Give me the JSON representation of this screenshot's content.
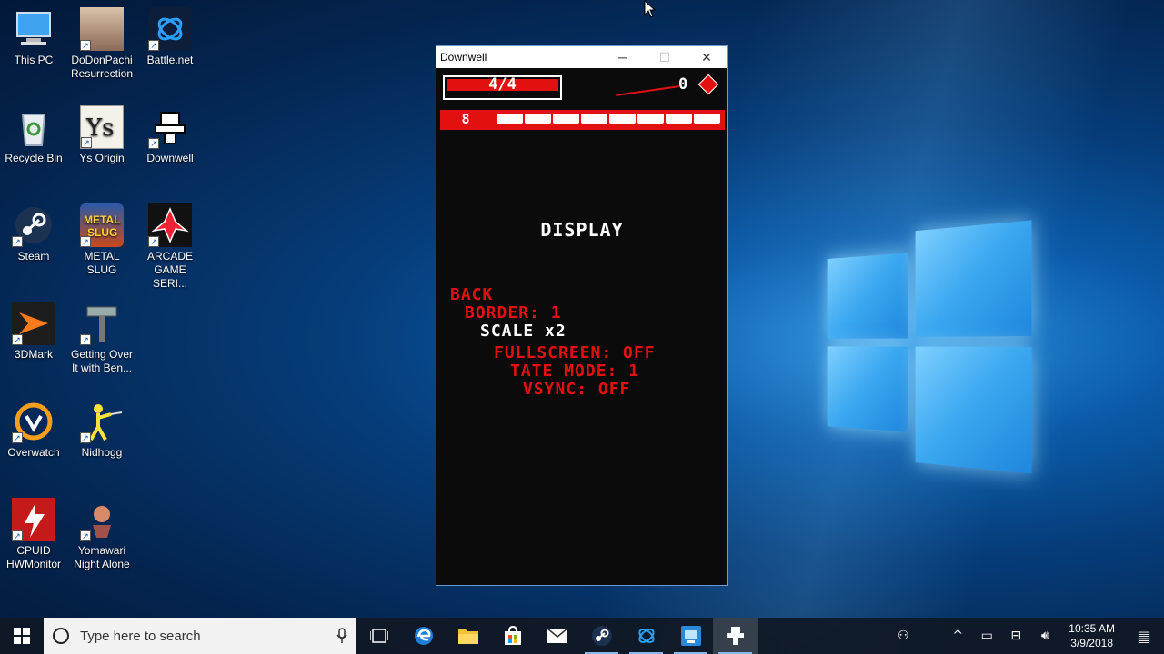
{
  "desktop": {
    "icons": [
      {
        "label": "This PC",
        "icon": "computer-icon"
      },
      {
        "label": "DoDonPachi Resurrection",
        "icon": "game-art-icon"
      },
      {
        "label": "Battle.net",
        "icon": "battlenet-icon"
      },
      {
        "label": "Recycle Bin",
        "icon": "recycle-bin-icon"
      },
      {
        "label": "Ys Origin",
        "icon": "ys-origin-icon"
      },
      {
        "label": "Downwell",
        "icon": "downwell-icon"
      },
      {
        "label": "Steam",
        "icon": "steam-icon"
      },
      {
        "label": "METAL SLUG",
        "icon": "metal-slug-icon"
      },
      {
        "label": "ARCADE GAME SERI...",
        "icon": "galaga-icon"
      },
      {
        "label": "3DMark",
        "icon": "3dmark-icon"
      },
      {
        "label": "Getting Over It with Ben...",
        "icon": "hammer-icon"
      },
      {
        "label": "Overwatch",
        "icon": "overwatch-icon"
      },
      {
        "label": "Nidhogg",
        "icon": "nidhogg-icon"
      },
      {
        "label": "CPUID HWMonitor",
        "icon": "hwmonitor-icon"
      },
      {
        "label": "Yomawari Night Alone",
        "icon": "yomawari-icon"
      }
    ]
  },
  "window": {
    "title": "Downwell",
    "minimize": "─",
    "maximize": "☐",
    "close": "✕"
  },
  "game": {
    "hp_text": "4/4",
    "hp_fraction": 1.0,
    "gem_count": "0",
    "ammo_count": "8",
    "ammo_slots": 8,
    "colors": {
      "red": "#e31010",
      "white": "#ffffff",
      "bg": "#0b0b0b"
    },
    "menu": {
      "title": "DISPLAY",
      "items": [
        {
          "label": "BACK"
        },
        {
          "label": "BORDER: 1"
        },
        {
          "label": "SCALE x2"
        },
        {
          "label": "FULLSCREEN: OFF"
        },
        {
          "label": "TATE MODE: 1"
        },
        {
          "label": "VSYNC: OFF"
        }
      ],
      "selected_item": "SCALE x2"
    }
  },
  "taskbar": {
    "search_placeholder": "Type here to search",
    "apps": [
      "task-view-icon",
      "edge-icon",
      "file-explorer-icon",
      "store-icon",
      "mail-icon",
      "steam-icon",
      "battlenet-icon",
      "app-icon",
      "downwell-icon"
    ],
    "active_app": "downwell-icon",
    "time": "10:35 AM",
    "date": "3/9/2018"
  }
}
